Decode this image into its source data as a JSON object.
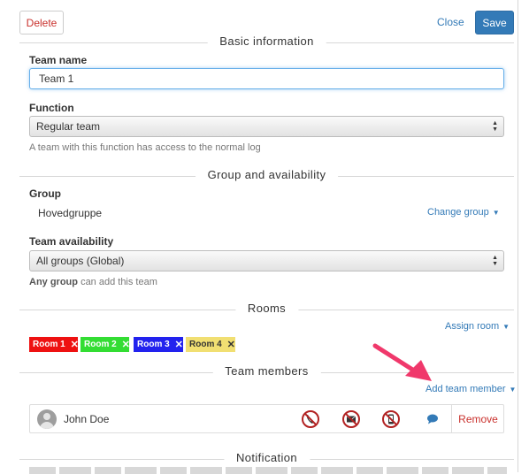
{
  "toolbar": {
    "delete_label": "Delete",
    "close_label": "Close",
    "save_label": "Save"
  },
  "basic": {
    "title": "Basic information",
    "team_name_label": "Team name",
    "team_name_value": "Team 1",
    "function_label": "Function",
    "function_value": "Regular team",
    "function_help": "A team with this function has access to the normal log"
  },
  "group_section": {
    "title": "Group and availability",
    "group_label": "Group",
    "group_value": "Hovedgruppe",
    "change_group_label": "Change group",
    "availability_label": "Team availability",
    "availability_value": "All groups (Global)",
    "any_group_bold": "Any group",
    "any_group_rest": "can add this team"
  },
  "rooms": {
    "title": "Rooms",
    "assign_label": "Assign room",
    "tags": [
      {
        "label": "Room 1",
        "color": "#ee1111",
        "text_color": "#ffffff"
      },
      {
        "label": "Room 2",
        "color": "#33dd33",
        "text_color": "#ffffff"
      },
      {
        "label": "Room 3",
        "color": "#2222ee",
        "text_color": "#ffffff"
      },
      {
        "label": "Room 4",
        "color": "#f1df72",
        "text_color": "#333333"
      }
    ],
    "remove_glyph": "✕"
  },
  "members": {
    "title": "Team members",
    "add_label": "Add team member",
    "rows": [
      {
        "name": "John Doe",
        "remove_label": "Remove"
      }
    ],
    "icons": [
      "no-phone-icon",
      "no-mail-icon",
      "no-mobile-icon",
      "chat-icon"
    ]
  },
  "notification": {
    "title": "Notification"
  },
  "colors": {
    "accent": "#337ab7",
    "danger": "#c9302c",
    "disabled_icon": "#b22222",
    "arrow": "#f0386b"
  }
}
